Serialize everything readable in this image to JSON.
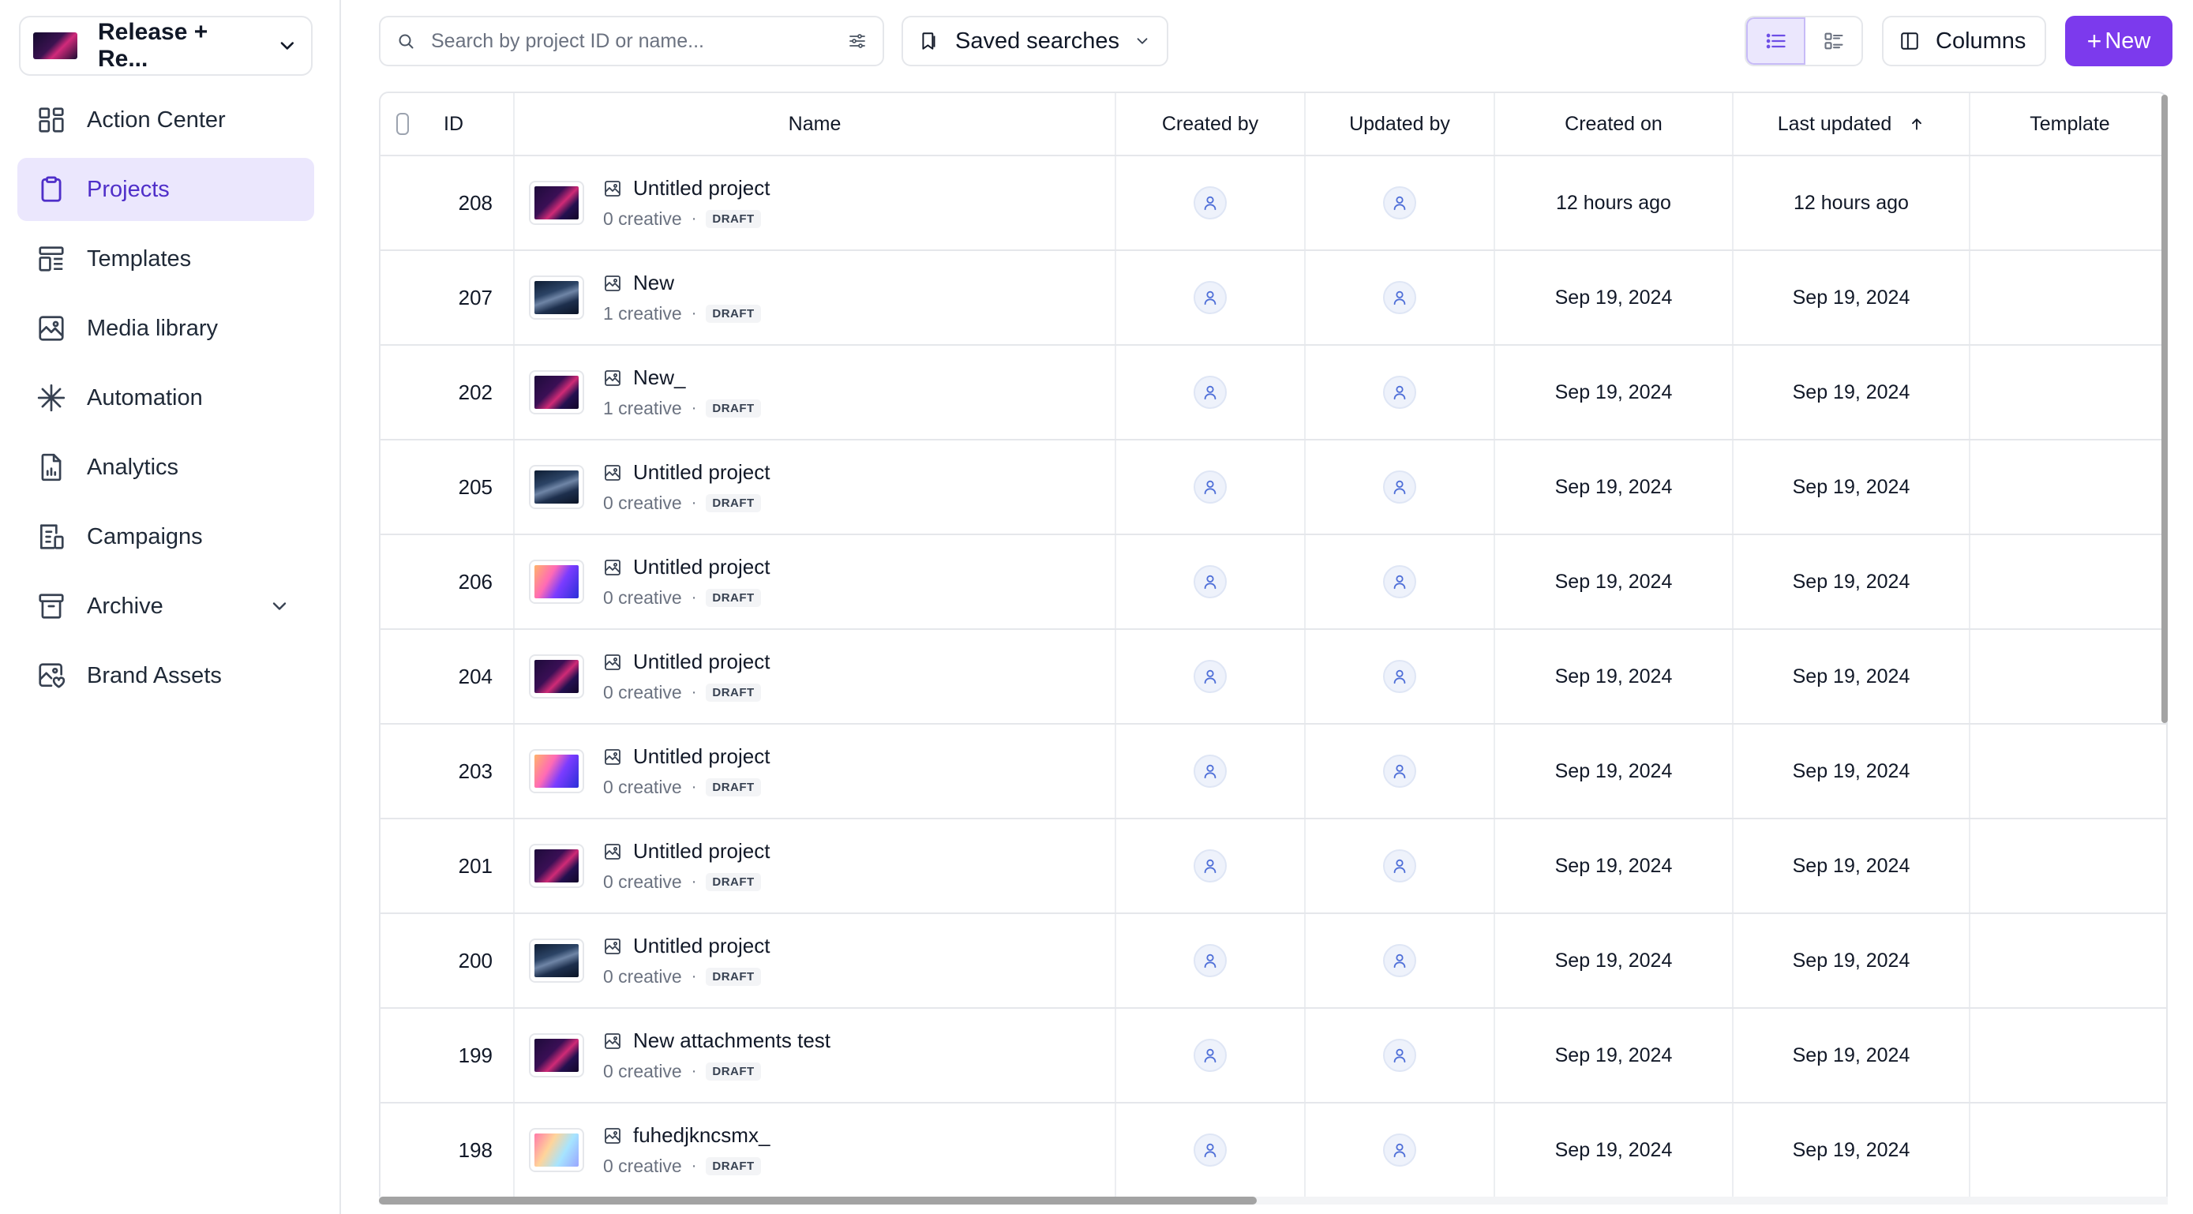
{
  "workspace": {
    "name": "Release + Re..."
  },
  "sidebar": {
    "items": [
      {
        "label": "Action Center",
        "icon": "action-center-icon",
        "active": false
      },
      {
        "label": "Projects",
        "icon": "clipboard-icon",
        "active": true
      },
      {
        "label": "Templates",
        "icon": "templates-icon",
        "active": false
      },
      {
        "label": "Media library",
        "icon": "image-icon",
        "active": false
      },
      {
        "label": "Automation",
        "icon": "sparkle-icon",
        "active": false
      },
      {
        "label": "Analytics",
        "icon": "analytics-icon",
        "active": false
      },
      {
        "label": "Campaigns",
        "icon": "campaigns-icon",
        "active": false
      },
      {
        "label": "Archive",
        "icon": "archive-icon",
        "active": false,
        "expandable": true
      },
      {
        "label": "Brand Assets",
        "icon": "brand-assets-icon",
        "active": false
      }
    ]
  },
  "toolbar": {
    "search_placeholder": "Search by project ID or name...",
    "saved_searches_label": "Saved searches",
    "columns_label": "Columns",
    "new_label": "New",
    "new_plus": "+"
  },
  "table": {
    "columns": {
      "id": "ID",
      "name": "Name",
      "created_by": "Created by",
      "updated_by": "Updated by",
      "created_on": "Created on",
      "last_updated": "Last updated",
      "template": "Template"
    },
    "sort": {
      "column": "Last updated",
      "direction": "ascending"
    },
    "rows": [
      {
        "id": "208",
        "name": "Untitled project",
        "creatives": "0 creative",
        "status": "DRAFT",
        "thumb": "purple",
        "created_on": "12 hours ago",
        "last_updated": "12 hours ago",
        "template": ""
      },
      {
        "id": "207",
        "name": "New",
        "creatives": "1 creative",
        "status": "DRAFT",
        "thumb": "dark",
        "created_on": "Sep 19, 2024",
        "last_updated": "Sep 19, 2024",
        "template": ""
      },
      {
        "id": "202",
        "name": "New_",
        "creatives": "1 creative",
        "status": "DRAFT",
        "thumb": "purple",
        "created_on": "Sep 19, 2024",
        "last_updated": "Sep 19, 2024",
        "template": ""
      },
      {
        "id": "205",
        "name": "Untitled project",
        "creatives": "0 creative",
        "status": "DRAFT",
        "thumb": "dark",
        "created_on": "Sep 19, 2024",
        "last_updated": "Sep 19, 2024",
        "template": ""
      },
      {
        "id": "206",
        "name": "Untitled project",
        "creatives": "0 creative",
        "status": "DRAFT",
        "thumb": "colorful",
        "created_on": "Sep 19, 2024",
        "last_updated": "Sep 19, 2024",
        "template": ""
      },
      {
        "id": "204",
        "name": "Untitled project",
        "creatives": "0 creative",
        "status": "DRAFT",
        "thumb": "purple",
        "created_on": "Sep 19, 2024",
        "last_updated": "Sep 19, 2024",
        "template": ""
      },
      {
        "id": "203",
        "name": "Untitled project",
        "creatives": "0 creative",
        "status": "DRAFT",
        "thumb": "colorful",
        "created_on": "Sep 19, 2024",
        "last_updated": "Sep 19, 2024",
        "template": ""
      },
      {
        "id": "201",
        "name": "Untitled project",
        "creatives": "0 creative",
        "status": "DRAFT",
        "thumb": "purple",
        "created_on": "Sep 19, 2024",
        "last_updated": "Sep 19, 2024",
        "template": ""
      },
      {
        "id": "200",
        "name": "Untitled project",
        "creatives": "0 creative",
        "status": "DRAFT",
        "thumb": "dark",
        "created_on": "Sep 19, 2024",
        "last_updated": "Sep 19, 2024",
        "template": ""
      },
      {
        "id": "199",
        "name": "New attachments test",
        "creatives": "0 creative",
        "status": "DRAFT",
        "thumb": "purple",
        "created_on": "Sep 19, 2024",
        "last_updated": "Sep 19, 2024",
        "template": ""
      },
      {
        "id": "198",
        "name": "fuhedjkncsmx_",
        "creatives": "0 creative",
        "status": "DRAFT",
        "thumb": "pastel",
        "created_on": "Sep 19, 2024",
        "last_updated": "Sep 19, 2024",
        "template": ""
      }
    ]
  },
  "colors": {
    "accent": "#7c3aed",
    "active_nav_bg": "#ebe7fd",
    "active_nav_text": "#4f2fc9",
    "avatar_icon": "#4f6fd8"
  }
}
